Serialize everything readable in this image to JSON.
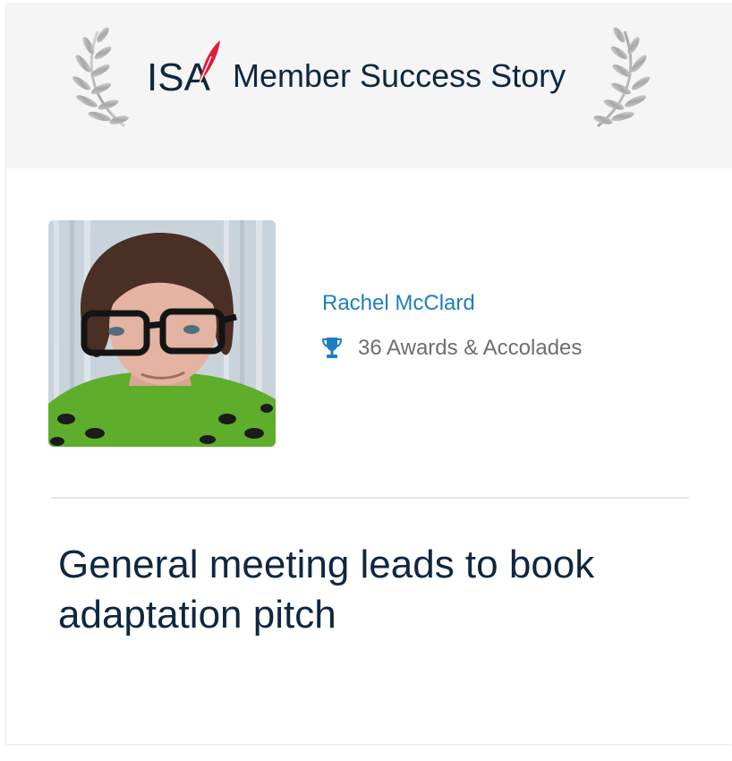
{
  "header": {
    "logo_text": "ISA",
    "title": "Member Success Story"
  },
  "member": {
    "name": "Rachel McClard",
    "awards_text": "36 Awards & Accolades"
  },
  "story": {
    "title": "General meeting leads to book adaptation pitch"
  },
  "colors": {
    "header_bg": "#f5f5f5",
    "brand_navy": "#0f2740",
    "brand_red": "#e3173e",
    "link_blue": "#1b7ec2",
    "muted_text": "#6e6e6e"
  },
  "icons": [
    "laurel-wreath-icon",
    "isa-logo",
    "trophy-icon"
  ]
}
